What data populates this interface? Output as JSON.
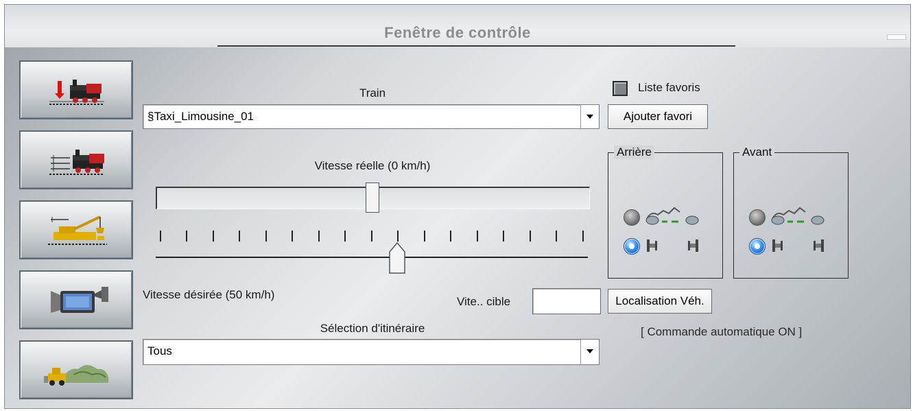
{
  "window": {
    "title": "Fenêtre de contrôle"
  },
  "sidebar": {
    "buttons": [
      {
        "name": "train-depart-icon"
      },
      {
        "name": "train-route-icon"
      },
      {
        "name": "crane-icon"
      },
      {
        "name": "camera-icon"
      },
      {
        "name": "landscape-bulldozer-icon"
      }
    ]
  },
  "train": {
    "label": "Train",
    "selected": "§Taxi_Limousine_01"
  },
  "favorites": {
    "checkbox_label": "Liste favoris",
    "add_button": "Ajouter favori"
  },
  "speed": {
    "actual_label": "Vitesse réelle (0 km/h)",
    "actual_value_fraction": 0.5,
    "desired_label": "Vitesse désirée (50 km/h)",
    "desired_value_fraction": 0.56,
    "tick_count": 17
  },
  "target": {
    "label": "Vite.. cible",
    "value": ""
  },
  "location_button": "Localisation Véh.",
  "auto_status": "[ Commande automatique ON ]",
  "itinerary": {
    "label": "Sélection d'itinéraire",
    "selected": "Tous"
  },
  "couplings": {
    "rear": {
      "label": "Arrière",
      "selected": "buffer"
    },
    "front": {
      "label": "Avant",
      "selected": "buffer"
    }
  }
}
